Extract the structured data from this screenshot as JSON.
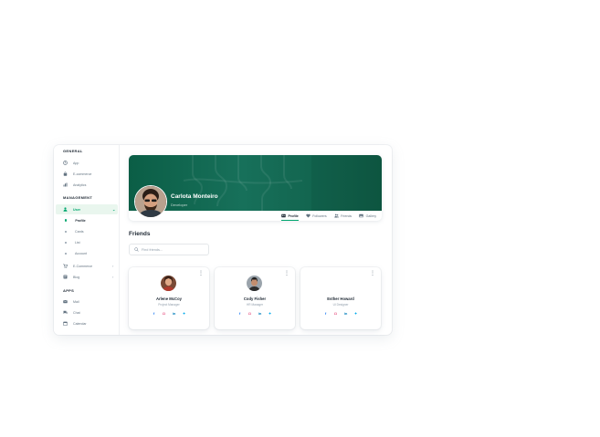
{
  "sidebar": {
    "sections": {
      "general": "GENERAL",
      "management": "MANAGEMENT",
      "apps": "APPS"
    },
    "items": [
      {
        "label": "App",
        "icon": "dashboard-icon"
      },
      {
        "label": "E-commerce",
        "icon": "shopping-bag-icon"
      },
      {
        "label": "Analytics",
        "icon": "chart-icon"
      },
      {
        "label": "User",
        "icon": "user-icon"
      },
      {
        "label": "E-Commerce",
        "icon": "cart-icon"
      },
      {
        "label": "Blog",
        "icon": "blog-icon"
      },
      {
        "label": "Mail",
        "icon": "mail-icon"
      },
      {
        "label": "Chat",
        "icon": "chat-icon"
      },
      {
        "label": "Calendar",
        "icon": "calendar-icon"
      }
    ],
    "subitems": [
      "Profile",
      "Cards",
      "List",
      "Account"
    ]
  },
  "profile": {
    "name": "Carlota Monteiro",
    "role": "Developer",
    "tabs": [
      "Profile",
      "Followers",
      "Friends",
      "Gallery"
    ]
  },
  "friends": {
    "title": "Friends",
    "search_placeholder": "Find friends...",
    "cards": [
      {
        "name": "Arlene McCoy",
        "role": "Project Manager"
      },
      {
        "name": "Cody Fisher",
        "role": "HR Manager"
      },
      {
        "name": "Esther Howard",
        "role": "UI Designer"
      }
    ]
  },
  "colors": {
    "accent": "#00a76f",
    "banner": "#0e6148"
  }
}
